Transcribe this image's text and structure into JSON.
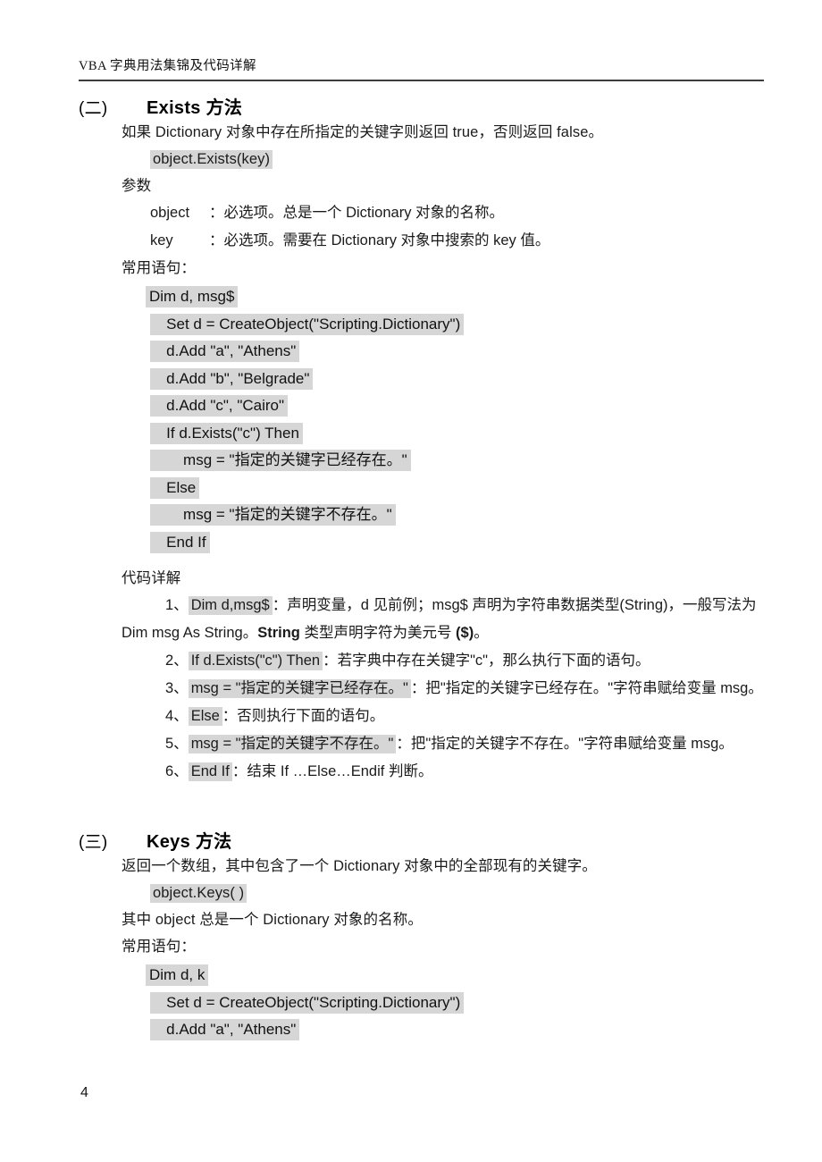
{
  "header": {
    "running_title": "VBA 字典用法集锦及代码详解"
  },
  "footer": {
    "page_number": "4"
  },
  "sections": [
    {
      "number": "(二)",
      "title": "Exists 方法",
      "intro": "如果 Dictionary 对象中存在所指定的关键字则返回 true，否则返回 false。",
      "syntax": "object.Exists(key)",
      "params_label": "参数",
      "params": [
        {
          "name": "object",
          "desc": "：必选项。总是一个 Dictionary 对象的名称。"
        },
        {
          "name": "key",
          "desc": "：必选项。需要在 Dictionary 对象中搜索的 key 值。"
        }
      ],
      "usage_label": "常用语句：",
      "code": [
        "Dim d, msg$",
        "   Set d = CreateObject(\"Scripting.Dictionary\")",
        "   d.Add \"a\", \"Athens\"",
        "   d.Add \"b\", \"Belgrade\"",
        "   d.Add \"c\", \"Cairo\"",
        "   If d.Exists(\"c\") Then",
        "       msg = \"指定的关键字已经存在。\"",
        "   Else",
        "       msg = \"指定的关键字不存在。\"",
        "   End If"
      ],
      "explain_label": "代码详解",
      "explain_items": [
        {
          "num": "1、",
          "code": "Dim d,msg$",
          "rest_a": "：声明变量，d 见前例；msg$ 声明为字符串数据类型(String)，一般写法为 Dim msg As String。",
          "bold_a": "String",
          "rest_b": " 类型声明字符为美元号 ",
          "bold_b": "($)",
          "rest_c": "。"
        },
        {
          "num": "2、",
          "code": "If d.Exists(\"c\") Then",
          "rest_a": "：若字典中存在关键字\"c\"，那么执行下面的语句。"
        },
        {
          "num": "3、",
          "code": "msg = \"指定的关键字已经存在。\"",
          "rest_a": "：把\"指定的关键字已经存在。\"字符串赋给变量 msg。"
        },
        {
          "num": "4、",
          "code": "Else",
          "rest_a": "：否则执行下面的语句。"
        },
        {
          "num": "5、",
          "code": "msg = \"指定的关键字不存在。\"",
          "rest_a": "：把\"指定的关键字不存在。\"字符串赋给变量 msg。"
        },
        {
          "num": "6、",
          "code": "End If",
          "rest_a": "：结束 If …Else…Endif 判断。"
        }
      ]
    },
    {
      "number": "(三)",
      "title": "Keys 方法",
      "intro": "返回一个数组，其中包含了一个 Dictionary 对象中的全部现有的关键字。",
      "syntax": "object.Keys( )",
      "note": "其中 object 总是一个 Dictionary 对象的名称。",
      "usage_label": "常用语句：",
      "code": [
        "Dim d, k",
        "   Set d = CreateObject(\"Scripting.Dictionary\")",
        "   d.Add \"a\", \"Athens\""
      ]
    }
  ],
  "colors": {
    "highlight": "#d6d6d6",
    "rule": "#3c3c3c",
    "text": "#1b1b1b"
  }
}
